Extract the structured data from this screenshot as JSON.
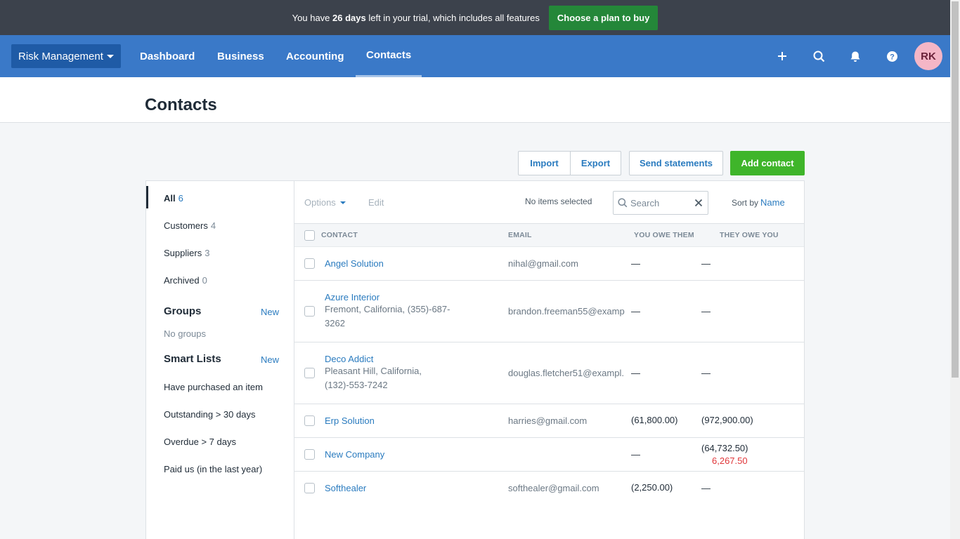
{
  "banner": {
    "text_before": "You have ",
    "days": "26 days",
    "text_after": " left in your trial, which includes all features",
    "cta": "Choose a plan to buy"
  },
  "nav": {
    "org": "Risk Management",
    "items": [
      "Dashboard",
      "Business",
      "Accounting",
      "Contacts"
    ],
    "active": "Contacts",
    "avatar_initials": "RK",
    "icons": [
      "plus-icon",
      "search-icon",
      "bell-icon",
      "help-icon"
    ]
  },
  "page": {
    "title": "Contacts"
  },
  "actions": {
    "import": "Import",
    "export": "Export",
    "send_statements": "Send statements",
    "add_contact": "Add contact"
  },
  "sidebar": {
    "filters": [
      {
        "label": "All",
        "count": "6"
      },
      {
        "label": "Customers",
        "count": "4"
      },
      {
        "label": "Suppliers",
        "count": "3"
      },
      {
        "label": "Archived",
        "count": "0"
      }
    ],
    "groups_heading": "Groups",
    "groups_new": "New",
    "groups_empty": "No groups",
    "smart_heading": "Smart Lists",
    "smart_new": "New",
    "smart_lists": [
      "Have purchased an item",
      "Outstanding > 30 days",
      "Overdue > 7 days",
      "Paid us (in the last year)"
    ]
  },
  "toolbar": {
    "options": "Options",
    "edit": "Edit",
    "selected": "No items selected",
    "search_placeholder": "Search",
    "sort_label": "Sort by",
    "sort_value": "Name"
  },
  "table": {
    "headers": {
      "contact": "CONTACT",
      "email": "EMAIL",
      "you_owe": "YOU OWE THEM",
      "they_owe": "THEY OWE YOU"
    },
    "rows": [
      {
        "name": "Angel Solution",
        "address": "",
        "email": "nihal@gmail.com",
        "you_owe": "—",
        "they_owe": "—",
        "they_owe_extra": ""
      },
      {
        "name": "Azure Interior",
        "address": "Fremont, California, (355)-687-3262",
        "email": "brandon.freeman55@examp",
        "you_owe": "—",
        "they_owe": "—",
        "they_owe_extra": ""
      },
      {
        "name": "Deco Addict",
        "address": "Pleasant Hill, California, (132)-553-7242",
        "email": "douglas.fletcher51@exampl.",
        "you_owe": "—",
        "they_owe": "—",
        "they_owe_extra": ""
      },
      {
        "name": "Erp Solution",
        "address": "",
        "email": "harries@gmail.com",
        "you_owe": "(61,800.00)",
        "they_owe": "(972,900.00)",
        "they_owe_extra": ""
      },
      {
        "name": "New Company",
        "address": "",
        "email": "",
        "you_owe": "—",
        "they_owe": "(64,732.50)",
        "they_owe_extra": "6,267.50"
      },
      {
        "name": "Softhealer",
        "address": "",
        "email": "softhealer@gmail.com",
        "you_owe": "(2,250.00)",
        "they_owe": "—",
        "they_owe_extra": ""
      }
    ]
  }
}
